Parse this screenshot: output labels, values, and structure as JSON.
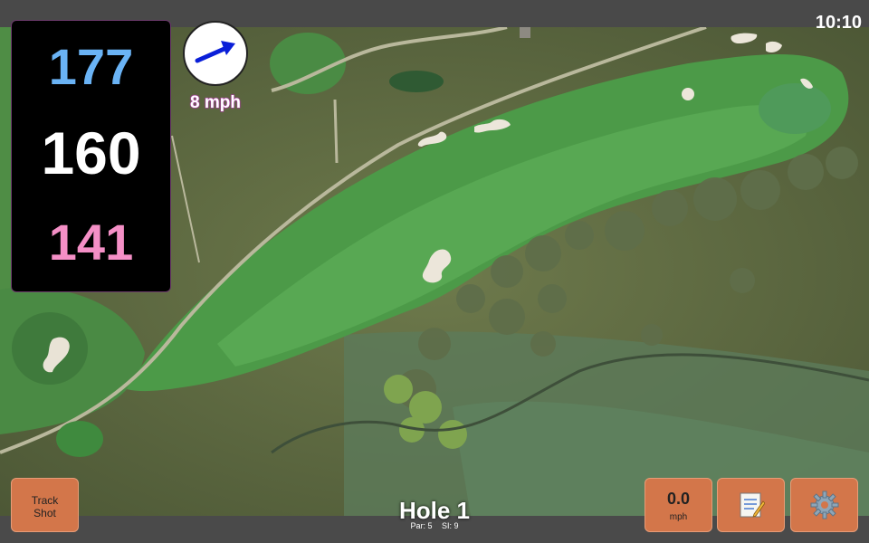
{
  "status_bar": {
    "time": "10:10"
  },
  "distances": {
    "back": "177",
    "middle": "160",
    "front": "141"
  },
  "wind": {
    "speed": "8 mph",
    "direction_icon": "arrow-right-up-icon"
  },
  "buttons": {
    "track_shot": "Track\nShot",
    "speed_value": "0.0",
    "speed_unit": "mph",
    "notes_icon": "memo-icon",
    "settings_icon": "gear-icon"
  },
  "hole": {
    "title": "Hole 1",
    "par": "Par: 5",
    "si": "SI: 9"
  },
  "colors": {
    "back_distance": "#6ab3f5",
    "middle_distance": "#ffffff",
    "front_distance": "#f48fc6",
    "button": "#d3764a",
    "wind_text_outline": "#b03aa8"
  }
}
